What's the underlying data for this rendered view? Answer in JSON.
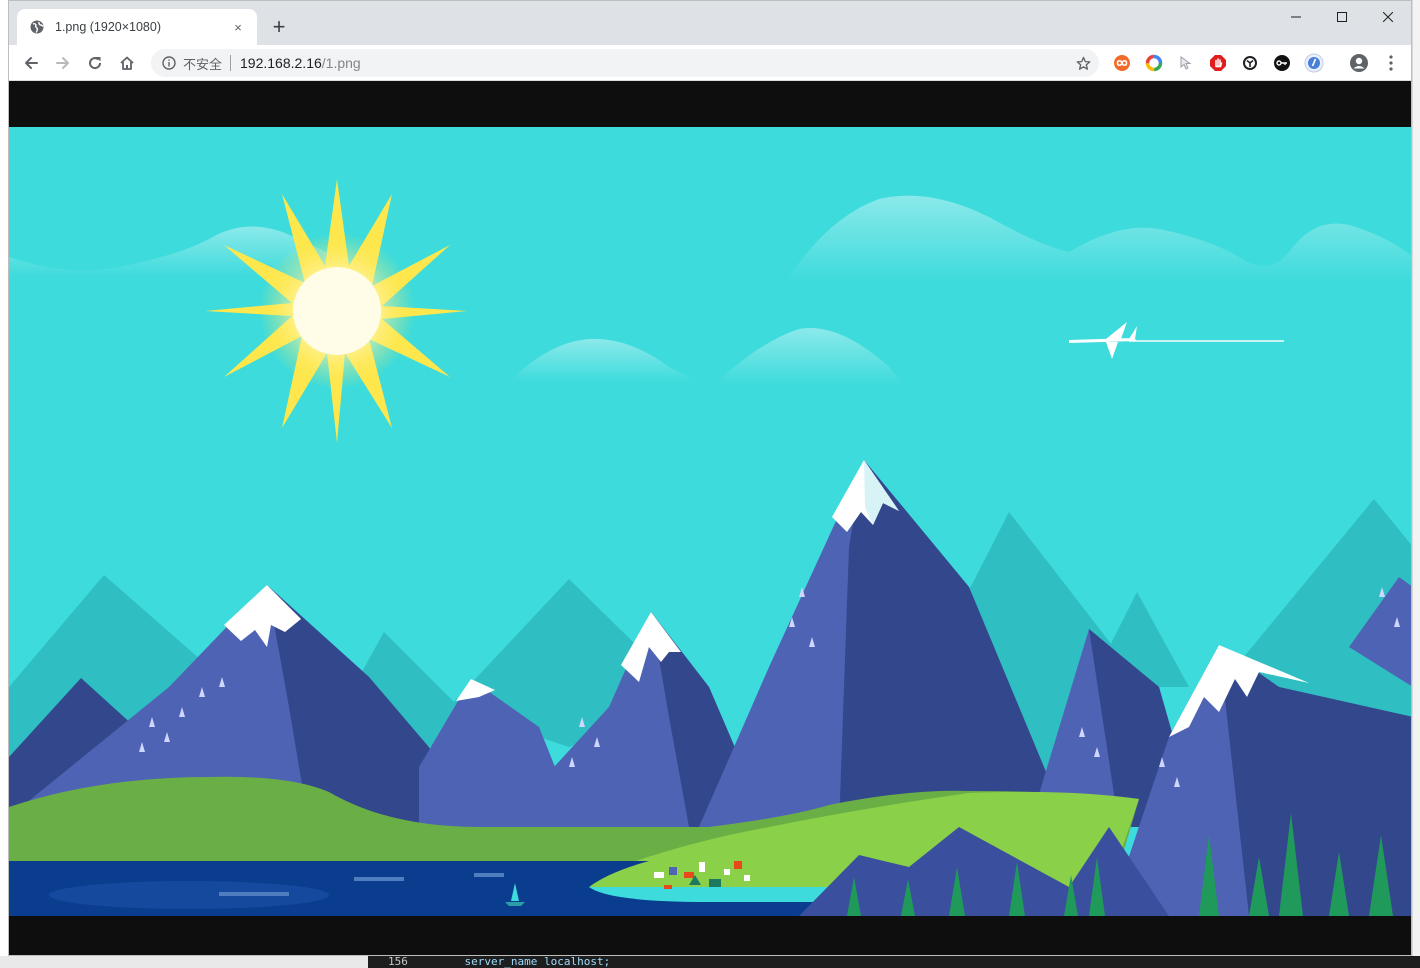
{
  "browser": {
    "tab": {
      "title": "1.png (1920×1080)",
      "close_glyph": "×",
      "favicon_icon": "globe-icon"
    },
    "new_tab_glyph": "+",
    "window_controls": [
      "minimize-icon",
      "maximize-icon",
      "close-icon"
    ],
    "toolbar": {
      "back_icon": "arrow-left-icon",
      "forward_icon": "arrow-right-icon",
      "reload_icon": "reload-icon",
      "home_icon": "home-icon"
    },
    "omnibox": {
      "security_label": "不安全",
      "url_host": "192.168.2.16",
      "url_path": "/1.png",
      "info_icon": "info-icon",
      "bookmark_icon": "star-icon"
    },
    "extensions": [
      "infinity-extension-icon",
      "color-ring-extension-icon",
      "cursor-extension-icon",
      "adblock-extension-icon",
      "sync-extension-icon",
      "key-extension-icon",
      "shield-extension-icon"
    ],
    "profile_icon": "profile-icon",
    "menu_icon": "kebab-menu-icon"
  },
  "content": {
    "image": "mountain-landscape-wallpaper",
    "colors": {
      "letterbox": "#0e0e0e",
      "sky": "#3ddbdc",
      "sun": "#fde74c",
      "mountain_dark": "#33478c",
      "mountain_light": "#4f63b4",
      "grass": "#7cc242",
      "water": "#0b3d8f"
    }
  },
  "background_editor": {
    "line_number": "156",
    "code_text": "server_name  localhost;"
  }
}
